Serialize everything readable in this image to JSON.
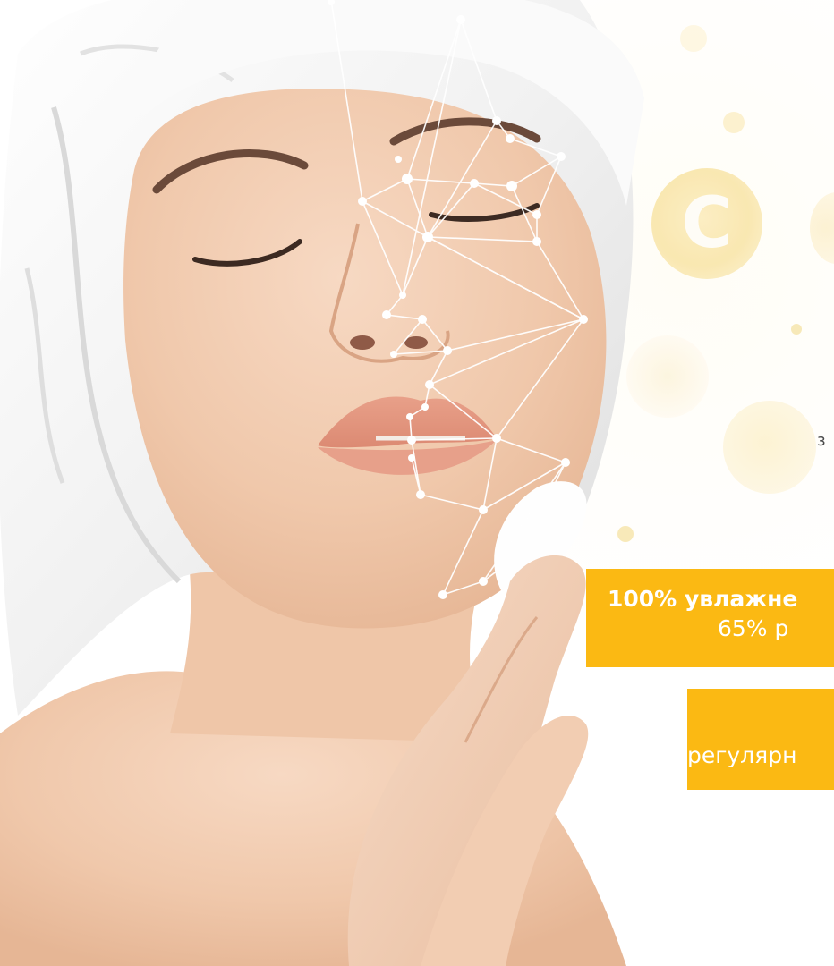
{
  "stray_letter": "з",
  "banner_main": {
    "line1": "100% увлажне",
    "line2": "65% р"
  },
  "banner_sub": {
    "line1": "регулярн"
  },
  "decor": {
    "bubble_letter": "C"
  },
  "colors": {
    "accent": "#fbb913",
    "banner_text": "#ffffff",
    "skin": "#f2cdb2",
    "towel": "#f5f5f5",
    "mesh": "#ffffff",
    "bubble": "#f8e19a"
  }
}
